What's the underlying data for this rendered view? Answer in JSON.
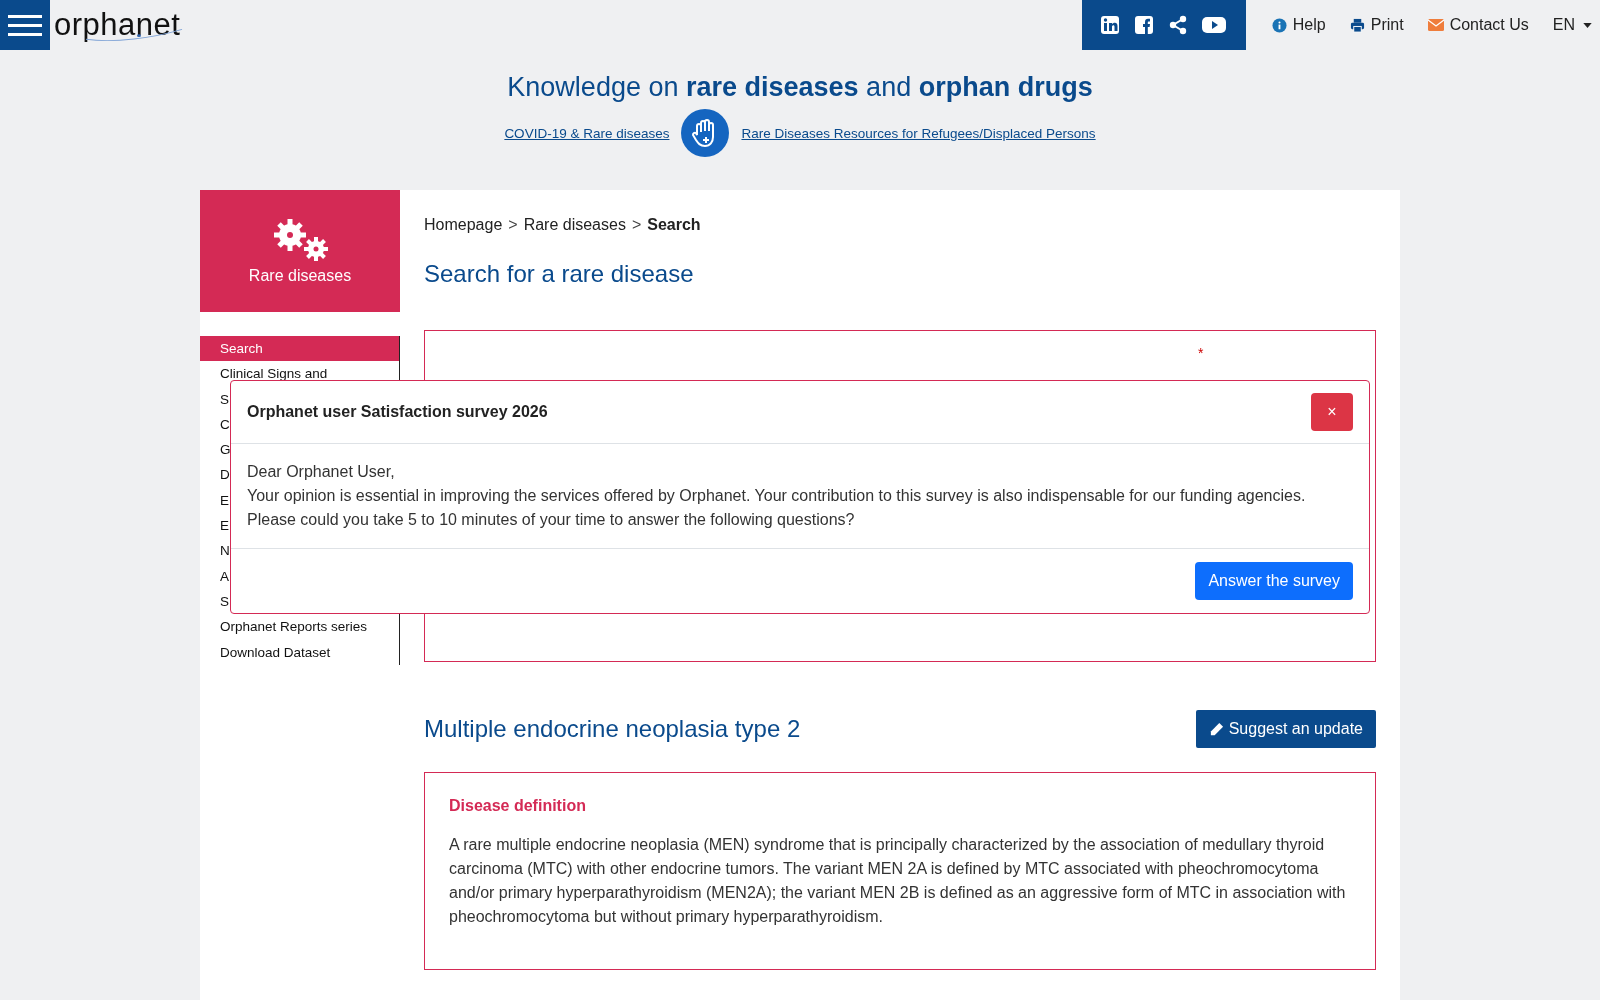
{
  "header": {
    "logo": "orphanet",
    "social": [
      {
        "kind": "linkedin"
      },
      {
        "kind": "facebook"
      },
      {
        "kind": "share"
      },
      {
        "kind": "youtube"
      }
    ],
    "nav": [
      {
        "kind": "help",
        "label": "Help"
      },
      {
        "kind": "print",
        "label": "Print"
      },
      {
        "kind": "contact",
        "label": "Contact Us"
      },
      {
        "kind": "language",
        "label": "EN"
      }
    ]
  },
  "tagline": "Knowledge on **rare diseases** and **orphan drugs**",
  "banner_links": [
    "COVID-19 & Rare diseases",
    "Rare Diseases Resources for Refugees/Displaced Persons"
  ],
  "section": {
    "title": "Rare diseases"
  },
  "sidebar": {
    "items": [
      {
        "label": "Search",
        "selected": true
      },
      {
        "label": "Clinical Signs and",
        "selected": false
      },
      {
        "label": "S",
        "selected": false
      },
      {
        "label": "C",
        "selected": false
      },
      {
        "label": "G",
        "selected": false
      },
      {
        "label": "D",
        "selected": false
      },
      {
        "label": "E",
        "selected": false
      },
      {
        "label": "E",
        "selected": false
      },
      {
        "label": "N",
        "selected": false
      },
      {
        "label": "A",
        "selected": false
      },
      {
        "label": "S",
        "selected": false
      },
      {
        "label": "Orphanet Reports series",
        "selected": false
      },
      {
        "label": "Download Dataset",
        "selected": false
      }
    ]
  },
  "breadcrumb": [
    {
      "kind": "link",
      "label": "Homepage"
    },
    {
      "kind": "separator",
      "label": ">"
    },
    {
      "kind": "link",
      "label": "Rare diseases"
    },
    {
      "kind": "separator",
      "label": ">"
    },
    {
      "kind": "current",
      "label": "Search"
    }
  ],
  "page_title": "Search for a rare disease",
  "search_panel": {
    "required_mark": "*"
  },
  "modal": {
    "title": "Orphanet user Satisfaction survey 2026",
    "close": "×",
    "lines": [
      "Dear Orphanet User,",
      "Your opinion is essential in improving the services offered by Orphanet. Your contribution to this survey is also indispensable for our funding agencies.",
      "Please could you take 5 to 10 minutes of your time to answer the following questions?"
    ],
    "button": "Answer the survey"
  },
  "disease": {
    "title": "Multiple endocrine neoplasia type 2",
    "update_button": "Suggest an update",
    "definition_heading": "Disease definition",
    "definition": "A rare multiple endocrine neoplasia (MEN) syndrome that is principally characterized by the association of medullary thyroid carcinoma (MTC) with other endocrine tumors. The variant MEN 2A is defined by MTC associated with pheochromocytoma and/or primary hyperparathyroidism (MEN2A); the variant MEN 2B is defined as an aggressive form of MTC in association with pheochromocytoma but without primary hyperparathyroidism."
  }
}
